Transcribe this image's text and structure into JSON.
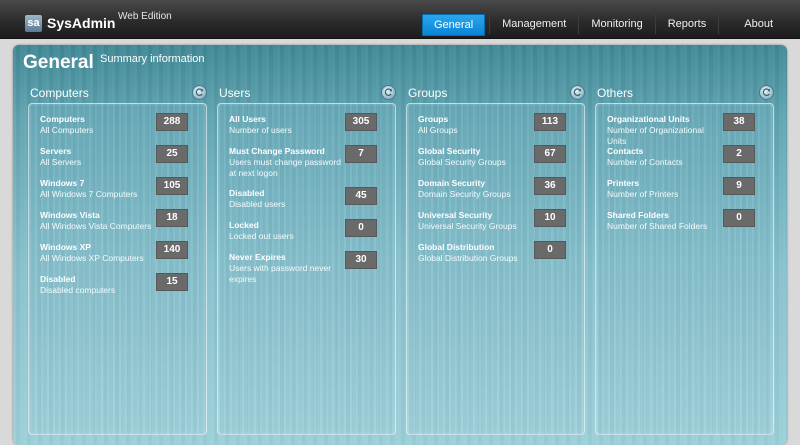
{
  "app": {
    "logo_text": "sa",
    "name": "SysAdmin",
    "edition": "Web Edition"
  },
  "nav": {
    "items": [
      {
        "label": "General",
        "active": true
      },
      {
        "label": "Management",
        "active": false
      },
      {
        "label": "Monitoring",
        "active": false
      },
      {
        "label": "Reports",
        "active": false
      },
      {
        "label": "About",
        "active": false
      }
    ]
  },
  "page": {
    "title": "General",
    "subtitle": "Summary information"
  },
  "sections": [
    {
      "title": "Computers",
      "rows": [
        {
          "title": "Computers",
          "desc": "All Computers",
          "count": "288"
        },
        {
          "title": "Servers",
          "desc": "All Servers",
          "count": "25"
        },
        {
          "title": "Windows 7",
          "desc": "All Windows 7 Computers",
          "count": "105"
        },
        {
          "title": "Windows Vista",
          "desc": "All Windows Vista Computers",
          "count": "18"
        },
        {
          "title": "Windows XP",
          "desc": "All Windows XP Computers",
          "count": "140"
        },
        {
          "title": "Disabled",
          "desc": "Disabled computers",
          "count": "15"
        }
      ]
    },
    {
      "title": "Users",
      "rows": [
        {
          "title": "All Users",
          "desc": "Number of users",
          "count": "305"
        },
        {
          "title": "Must Change Password",
          "desc": "Users must change password at next logon",
          "count": "7"
        },
        {
          "title": "Disabled",
          "desc": "Disabled users",
          "count": "45"
        },
        {
          "title": "Locked",
          "desc": "Locked out users",
          "count": "0"
        },
        {
          "title": "Never Expires",
          "desc": "Users with password never expires",
          "count": "30"
        }
      ]
    },
    {
      "title": "Groups",
      "rows": [
        {
          "title": "Groups",
          "desc": "All Groups",
          "count": "113"
        },
        {
          "title": "Global Security",
          "desc": "Global Security Groups",
          "count": "67"
        },
        {
          "title": "Domain Security",
          "desc": "Domain Security Groups",
          "count": "36"
        },
        {
          "title": "Universal Security",
          "desc": "Universal Security Groups",
          "count": "10"
        },
        {
          "title": "Global Distribution",
          "desc": "Global Distribution Groups",
          "count": "0"
        }
      ]
    },
    {
      "title": "Others",
      "rows": [
        {
          "title": "Organizational Units",
          "desc": "Number of Organizational Units",
          "count": "38"
        },
        {
          "title": "Contacts",
          "desc": "Number of Contacts",
          "count": "2"
        },
        {
          "title": "Printers",
          "desc": "Number of Printers",
          "count": "9"
        },
        {
          "title": "Shared Folders",
          "desc": "Number of Shared Folders",
          "count": "0"
        }
      ]
    }
  ],
  "colors": {
    "nav_active": "#1996e6",
    "count_badge": "#6a6a6a",
    "panel": "#6fb1be"
  },
  "icons": {
    "refresh": "refresh-icon"
  }
}
